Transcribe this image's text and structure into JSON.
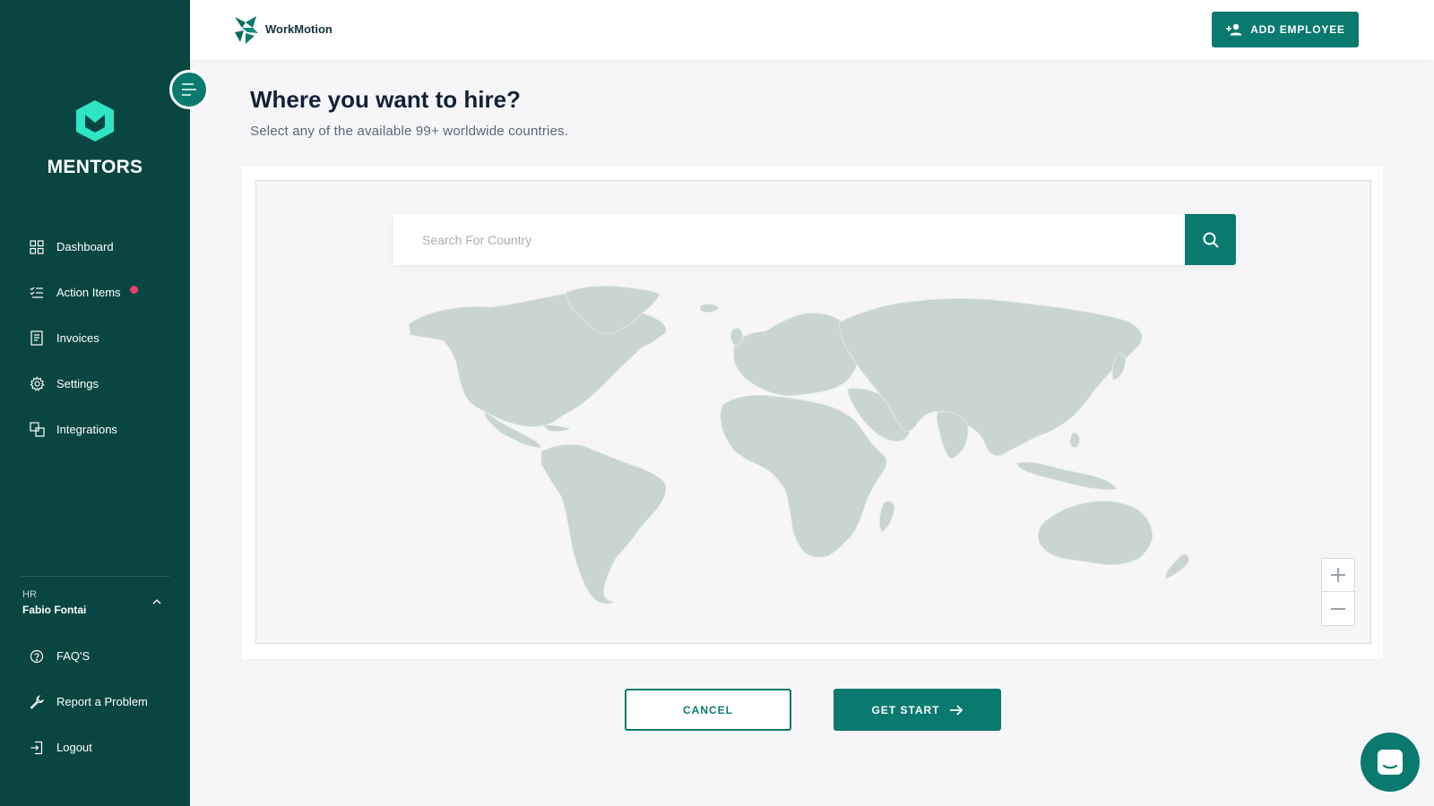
{
  "sidebar": {
    "brand_name": "MENTORS",
    "items": [
      {
        "label": "Dashboard",
        "icon": "grid-icon"
      },
      {
        "label": "Action Items",
        "icon": "checklist-icon",
        "badge": true
      },
      {
        "label": "Invoices",
        "icon": "invoice-icon"
      },
      {
        "label": "Settings",
        "icon": "gear-icon"
      },
      {
        "label": "Integrations",
        "icon": "integrations-icon"
      }
    ],
    "user": {
      "role": "HR",
      "name": "Fabio Fontai"
    },
    "bottom_items": [
      {
        "label": "FAQ'S",
        "icon": "help-circle-icon"
      },
      {
        "label": "Report a Problem",
        "icon": "wrench-icon"
      },
      {
        "label": "Logout",
        "icon": "logout-icon"
      }
    ]
  },
  "header": {
    "logo_text": "WorkMotion",
    "add_employee_label": "ADD EMPLOYEE"
  },
  "main": {
    "title": "Where you want to hire?",
    "subtitle": "Select any of the available 99+ worldwide countries.",
    "search": {
      "placeholder": "Search For Country",
      "value": ""
    },
    "cancel_label": "CANCEL",
    "start_label": "GET START"
  },
  "colors": {
    "sidebar_bg": "#0a4641",
    "accent": "#0a7a6e",
    "brand_logo": "#2ee6c4",
    "map_land": "#c9d5d1",
    "badge": "#ee3e70"
  }
}
